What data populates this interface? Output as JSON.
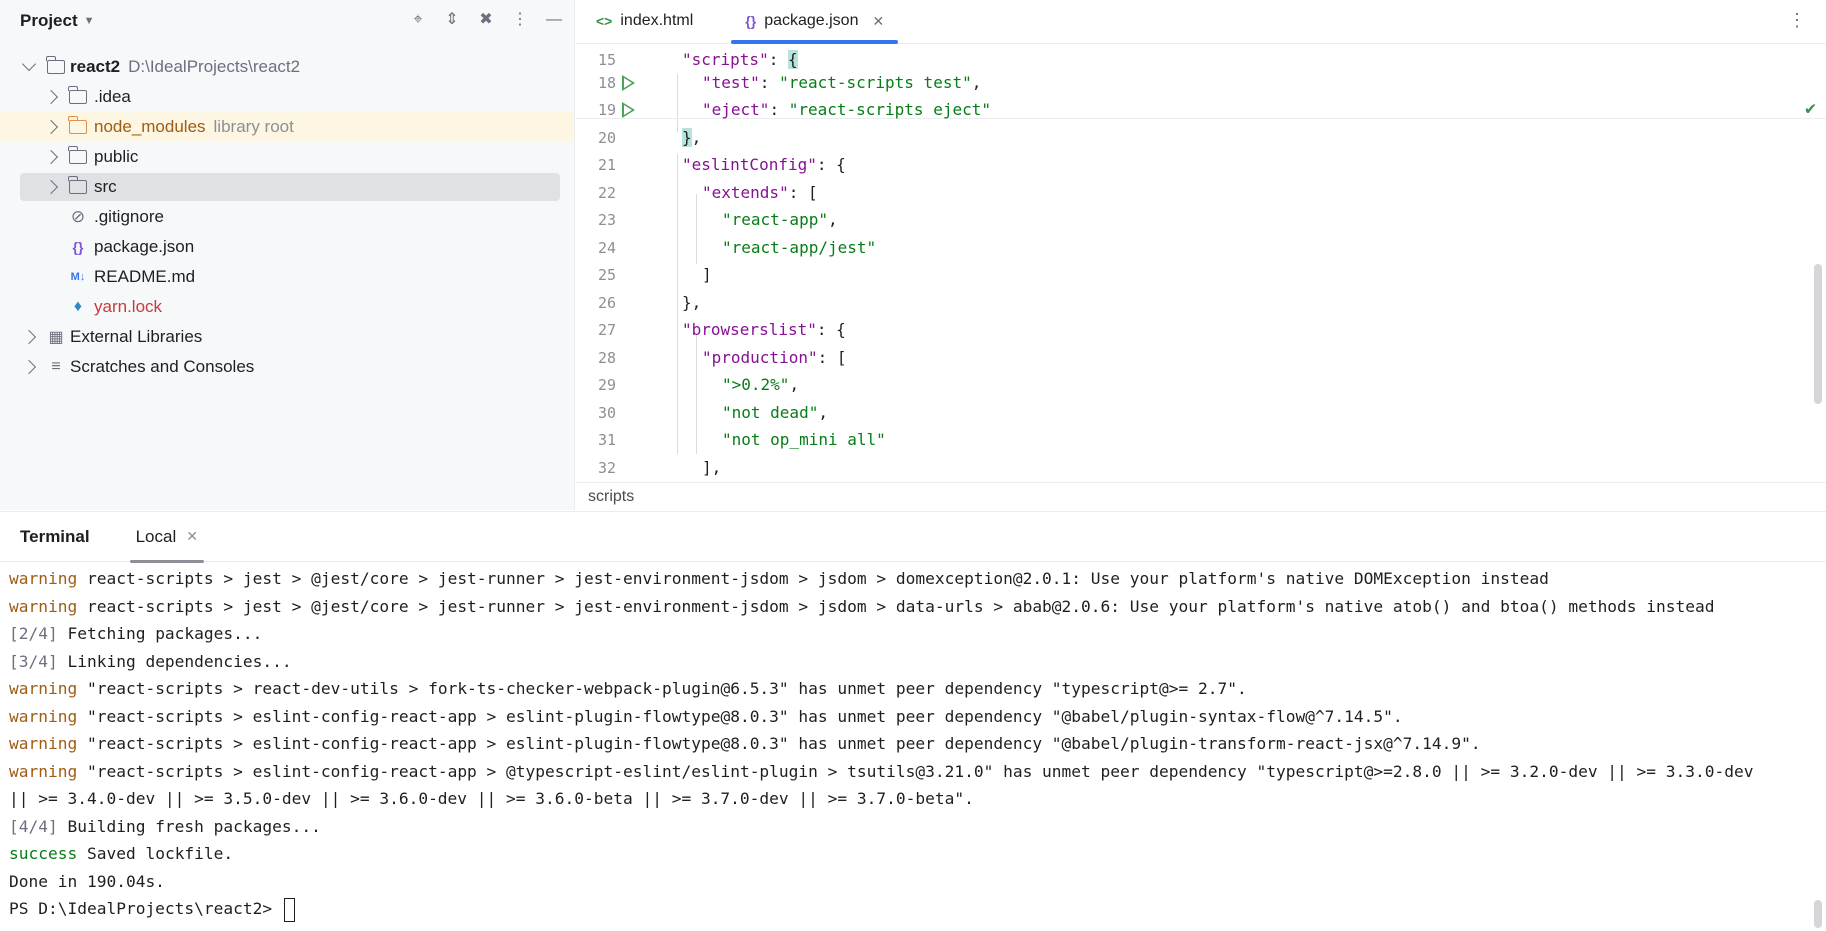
{
  "project": {
    "title": "Project",
    "tree": {
      "root_name": "react2",
      "root_path": "D:\\IdealProjects\\react2",
      "items": [
        {
          "label": ".idea",
          "extra": ""
        },
        {
          "label": "node_modules",
          "extra": "library root"
        },
        {
          "label": "public",
          "extra": ""
        },
        {
          "label": "src",
          "extra": ""
        },
        {
          "label": ".gitignore",
          "extra": ""
        },
        {
          "label": "package.json",
          "extra": ""
        },
        {
          "label": "README.md",
          "extra": ""
        },
        {
          "label": "yarn.lock",
          "extra": ""
        }
      ],
      "external_libraries": "External Libraries",
      "scratches": "Scratches and Consoles"
    }
  },
  "editor": {
    "tabs": [
      {
        "label": "index.html",
        "icon": "html-file-icon"
      },
      {
        "label": "package.json",
        "icon": "json-file-icon"
      }
    ],
    "active_tab": "package.json",
    "lines": [
      {
        "num": "15",
        "text": "\"scripts\": {"
      },
      {
        "num": "18",
        "text": "\"test\": \"react-scripts test\","
      },
      {
        "num": "19",
        "text": "\"eject\": \"react-scripts eject\""
      },
      {
        "num": "20",
        "text": "},"
      },
      {
        "num": "21",
        "text": "\"eslintConfig\": {"
      },
      {
        "num": "22",
        "text": "\"extends\": ["
      },
      {
        "num": "23",
        "text": "\"react-app\","
      },
      {
        "num": "24",
        "text": "\"react-app/jest\""
      },
      {
        "num": "25",
        "text": "]"
      },
      {
        "num": "26",
        "text": "},"
      },
      {
        "num": "27",
        "text": "\"browserslist\": {"
      },
      {
        "num": "28",
        "text": "\"production\": ["
      },
      {
        "num": "29",
        "text": "\">0.2%\","
      },
      {
        "num": "30",
        "text": "\"not dead\","
      },
      {
        "num": "31",
        "text": "\"not op_mini all\""
      },
      {
        "num": "32",
        "text": "],"
      }
    ],
    "breadcrumb": "scripts"
  },
  "terminal": {
    "title": "Terminal",
    "tab_label": "Local",
    "lines": [
      {
        "prefix": "warning",
        "kind": "warn",
        "text": " react-scripts > jest > @jest/core > jest-runner > jest-environment-jsdom > jsdom > domexception@2.0.1: Use your platform's native DOMException instead"
      },
      {
        "prefix": "warning",
        "kind": "warn",
        "text": " react-scripts > jest > @jest/core > jest-runner > jest-environment-jsdom > jsdom > data-urls > abab@2.0.6: Use your platform's native atob() and btoa() methods instead"
      },
      {
        "prefix": "[2/4]",
        "kind": "dim",
        "text": " Fetching packages..."
      },
      {
        "prefix": "[3/4]",
        "kind": "dim",
        "text": " Linking dependencies..."
      },
      {
        "prefix": "warning",
        "kind": "warn",
        "text": " \"react-scripts > react-dev-utils > fork-ts-checker-webpack-plugin@6.5.3\" has unmet peer dependency \"typescript@>= 2.7\"."
      },
      {
        "prefix": "warning",
        "kind": "warn",
        "text": " \"react-scripts > eslint-config-react-app > eslint-plugin-flowtype@8.0.3\" has unmet peer dependency \"@babel/plugin-syntax-flow@^7.14.5\"."
      },
      {
        "prefix": "warning",
        "kind": "warn",
        "text": " \"react-scripts > eslint-config-react-app > eslint-plugin-flowtype@8.0.3\" has unmet peer dependency \"@babel/plugin-transform-react-jsx@^7.14.9\"."
      },
      {
        "prefix": "warning",
        "kind": "warn",
        "text": " \"react-scripts > eslint-config-react-app > @typescript-eslint/eslint-plugin > tsutils@3.21.0\" has unmet peer dependency \"typescript@>=2.8.0 || >= 3.2.0-dev || >= 3.3.0-dev"
      },
      {
        "prefix": "",
        "kind": "",
        "text": "|| >= 3.4.0-dev || >= 3.5.0-dev || >= 3.6.0-dev || >= 3.6.0-beta || >= 3.7.0-dev || >= 3.7.0-beta\"."
      },
      {
        "prefix": "[4/4]",
        "kind": "dim",
        "text": " Building fresh packages..."
      },
      {
        "prefix": "success",
        "kind": "succ",
        "text": " Saved lockfile."
      },
      {
        "prefix": "",
        "kind": "",
        "text": "Done in 190.04s."
      }
    ],
    "prompt": "PS D:\\IdealProjects\\react2> "
  }
}
